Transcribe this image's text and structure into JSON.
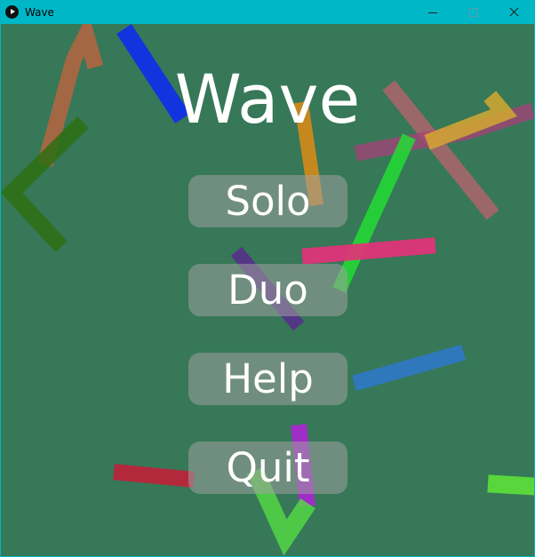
{
  "window": {
    "title": "Wave",
    "titlebar_color": "#00b7c8",
    "background_color": "#367858",
    "controls": [
      "minimize-icon",
      "maximize-icon",
      "close-icon"
    ]
  },
  "game": {
    "title": "Wave"
  },
  "menu": {
    "solo": "Solo",
    "duo": "Duo",
    "help": "Help",
    "quit": "Quit"
  },
  "trail_colors": {
    "orange_red": "#c8623e",
    "dark_green": "#2e6e12",
    "blue": "#1130e6",
    "orange": "#d58a1a",
    "pink_x": "#c86070",
    "magenta": "#a8407a",
    "yellow": "#d4a830",
    "green": "#22dd33",
    "hot_pink": "#e8307a",
    "purple": "#5a2890",
    "light_blue": "#2e78cc",
    "violet": "#b020d8",
    "crimson": "#c0203a",
    "lime": "#55dd44",
    "bright_green": "#5ce03a"
  }
}
